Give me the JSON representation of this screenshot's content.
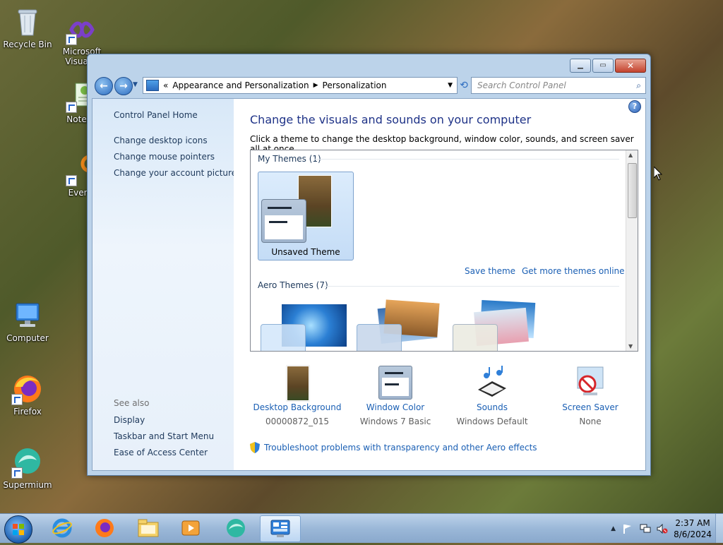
{
  "desktop": {
    "icons": [
      {
        "label": "Recycle Bin",
        "icon": "recycle-bin-icon"
      },
      {
        "label": "Microsoft Visual S",
        "icon": "visual-studio-icon"
      },
      {
        "label": "Notepa",
        "icon": "notepad-icon"
      },
      {
        "label": "Everyt",
        "icon": "everything-icon"
      },
      {
        "label": "Computer",
        "icon": "computer-icon"
      },
      {
        "label": "Firefox",
        "icon": "firefox-icon"
      },
      {
        "label": "Supermium",
        "icon": "supermium-icon"
      }
    ]
  },
  "window": {
    "breadcrumb": {
      "root_chevron": "«",
      "items": [
        "Appearance and Personalization",
        "Personalization"
      ]
    },
    "search_placeholder": "Search Control Panel",
    "sidebar": {
      "home": "Control Panel Home",
      "links": [
        "Change desktop icons",
        "Change mouse pointers",
        "Change your account picture"
      ],
      "see_also_label": "See also",
      "see_also": [
        "Display",
        "Taskbar and Start Menu",
        "Ease of Access Center"
      ]
    },
    "main": {
      "heading": "Change the visuals and sounds on your computer",
      "subtext": "Click a theme to change the desktop background, window color, sounds, and screen saver all at once.",
      "my_themes_label": "My Themes (1)",
      "unsaved_theme": "Unsaved Theme",
      "save_theme": "Save theme",
      "get_more_themes": "Get more themes online",
      "aero_themes_label": "Aero Themes (7)"
    },
    "settings": [
      {
        "name": "Desktop Background",
        "value": "00000872_015",
        "icon": "desktop-background-icon"
      },
      {
        "name": "Window Color",
        "value": "Windows 7 Basic",
        "icon": "window-color-icon"
      },
      {
        "name": "Sounds",
        "value": "Windows Default",
        "icon": "sounds-icon"
      },
      {
        "name": "Screen Saver",
        "value": "None",
        "icon": "screen-saver-icon"
      }
    ],
    "troubleshoot_link": "Troubleshoot problems with transparency and other Aero effects"
  },
  "taskbar": {
    "pinned": [
      "internet-explorer-icon",
      "firefox-icon",
      "file-explorer-icon",
      "media-player-icon",
      "supermium-icon",
      "control-panel-icon"
    ],
    "time": "2:37 AM",
    "date": "8/6/2024"
  },
  "colors": {
    "link_blue": "#1a5fb4",
    "heading_blue": "#1e3287",
    "selection_blue": "#c4dcf6"
  }
}
